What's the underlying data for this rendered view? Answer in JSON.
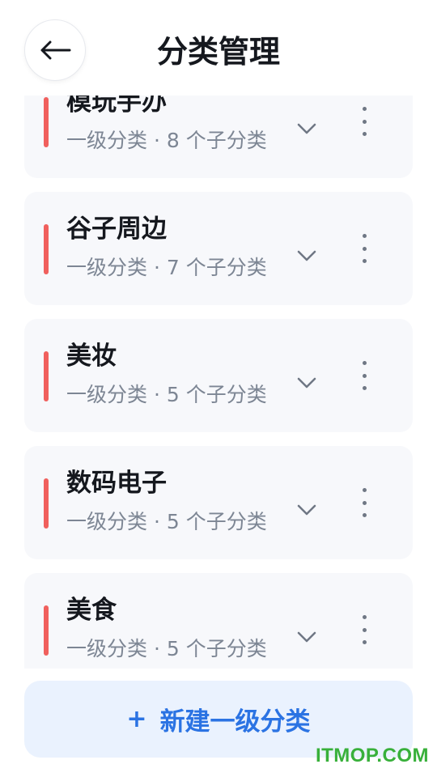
{
  "header": {
    "title": "分类管理",
    "back_icon": "arrow-left-icon"
  },
  "categories": [
    {
      "name": "模玩手办",
      "meta": "一级分类 · 8 个子分类",
      "color": "#f0605d"
    },
    {
      "name": "谷子周边",
      "meta": "一级分类 · 7 个子分类",
      "color": "#f0605d"
    },
    {
      "name": "美妆",
      "meta": "一级分类 · 5 个子分类",
      "color": "#f0605d"
    },
    {
      "name": "数码电子",
      "meta": "一级分类 · 5 个子分类",
      "color": "#f0605d"
    },
    {
      "name": "美食",
      "meta": "一级分类 · 5 个子分类",
      "color": "#f0605d"
    }
  ],
  "footer": {
    "plus": "+",
    "label": "新建一级分类"
  },
  "watermark": "ITMOP.COM",
  "colors": {
    "accent": "#2b73e3",
    "marker": "#f0605d",
    "watermark": "#38b03a"
  }
}
